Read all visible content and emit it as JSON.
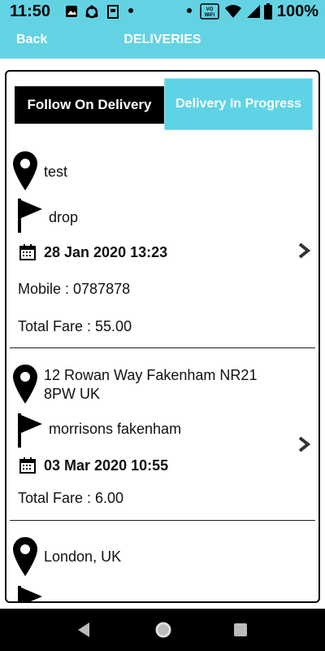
{
  "status": {
    "time": "11:50",
    "battery": "100%"
  },
  "header": {
    "back_label": "Back",
    "title": "DELIVERIES"
  },
  "tabs": [
    {
      "label": "Follow On Delivery",
      "active": false
    },
    {
      "label": "Delivery In Progress",
      "active": true
    }
  ],
  "deliveries": [
    {
      "pickup": "test",
      "drop": "drop",
      "datetime": "28 Jan 2020 13:23",
      "mobile": "Mobile : 0787878",
      "fare": "Total Fare : 55.00"
    },
    {
      "pickup_line1": "12 Rowan Way  Fakenham NR21",
      "pickup_line2": "8PW  UK",
      "drop": "morrisons fakenham",
      "datetime": "03 Mar 2020 10:55",
      "fare": "Total Fare : 6.00"
    },
    {
      "pickup": "London, UK"
    }
  ],
  "colors": {
    "accent": "#63d3e4",
    "tab_active": "#000000"
  }
}
